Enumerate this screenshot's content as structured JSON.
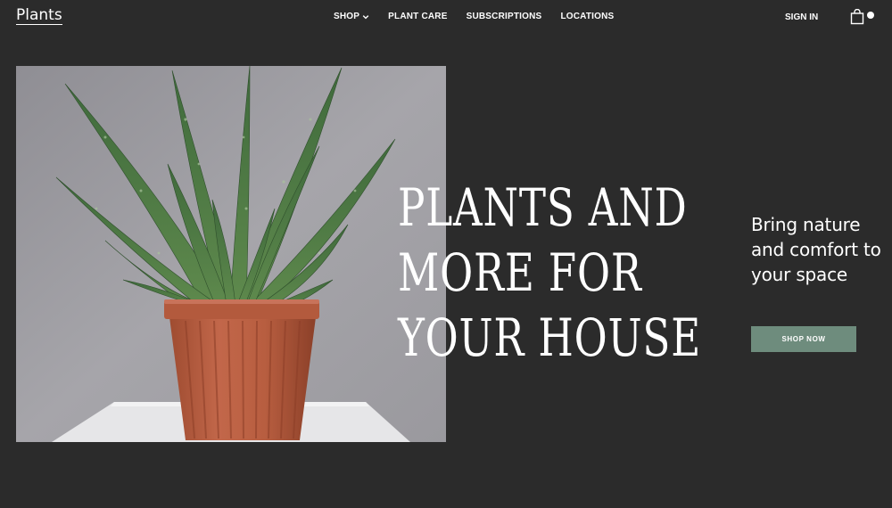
{
  "brand": {
    "logo_text": "Plants"
  },
  "nav": {
    "items": [
      {
        "label": "SHOP",
        "has_dropdown": true
      },
      {
        "label": "PLANT CARE",
        "has_dropdown": false
      },
      {
        "label": "SUBSCRIPTIONS",
        "has_dropdown": false
      },
      {
        "label": "LOCATIONS",
        "has_dropdown": false
      }
    ],
    "sign_in_label": "SIGN IN",
    "cart_icon": "shopping-bag-icon"
  },
  "hero": {
    "headline_lines": [
      "PLANTS AND",
      "MORE FOR",
      "YOUR HOUSE"
    ],
    "subtitle": "Bring nature and comfort to your space",
    "cta_label": "SHOP NOW",
    "image_subject": "aloe plant in terracotta pot"
  },
  "colors": {
    "background": "#2b2b2b",
    "accent_button": "#6e8c7d",
    "text": "#ffffff"
  }
}
